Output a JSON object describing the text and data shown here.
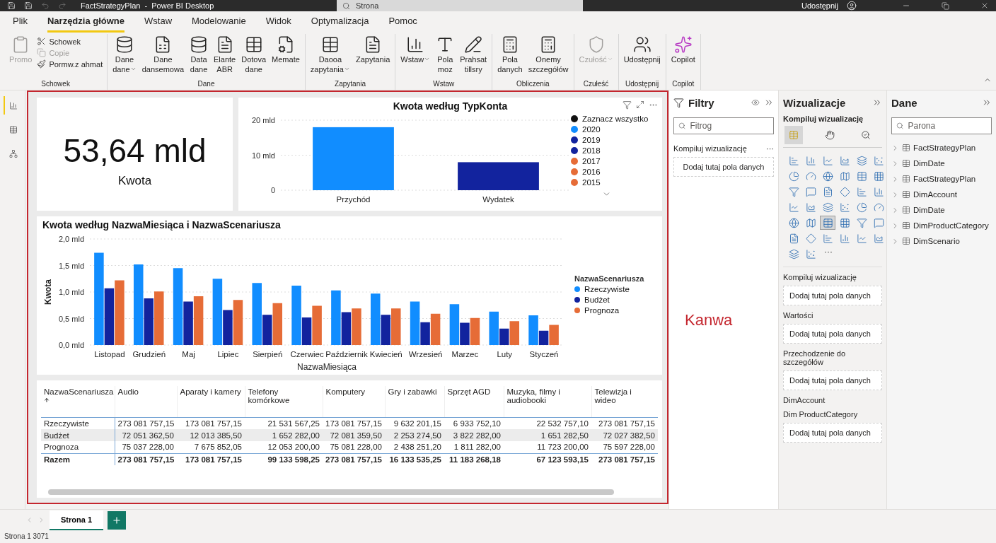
{
  "title_bar": {
    "title": "FactStrategyPlan  -  Power BI Desktop",
    "search": {
      "placeholder": "Strona"
    },
    "share": "Udostępnij"
  },
  "ribbon_tabs": [
    {
      "label": "Plik",
      "selected": false
    },
    {
      "label": "Narzędzia główne",
      "selected": true
    },
    {
      "label": "Wstaw",
      "selected": false
    },
    {
      "label": "Modelowanie",
      "selected": false
    },
    {
      "label": "Widok",
      "selected": false
    },
    {
      "label": "Optymalizacja",
      "selected": false
    },
    {
      "label": "Pomoc",
      "selected": false
    }
  ],
  "ribbon_groups": [
    {
      "label": "Schowek",
      "buttons": [
        {
          "kind": "large",
          "label": "Promo",
          "disabled": true,
          "dropdown": false
        },
        {
          "kind": "small",
          "label": "Schowek",
          "disabled": false,
          "dropdown": false
        },
        {
          "kind": "small",
          "label": "Copie",
          "disabled": true,
          "dropdown": false
        },
        {
          "kind": "small",
          "label": "Pormw.z ahmat",
          "disabled": false,
          "dropdown": false
        }
      ]
    },
    {
      "label": "Dane",
      "buttons": [
        {
          "kind": "large",
          "label": "Dane\ndane",
          "disabled": false,
          "dropdown": true
        },
        {
          "kind": "large",
          "label": "Dane\ndansemowa",
          "disabled": false,
          "dropdown": false
        },
        {
          "kind": "large",
          "label": "Data\ndane",
          "disabled": false,
          "dropdown": false
        },
        {
          "kind": "large",
          "label": "Elante\nABR",
          "disabled": false,
          "dropdown": false
        },
        {
          "kind": "large",
          "label": "Dotova\ndane",
          "disabled": false,
          "dropdown": false
        },
        {
          "kind": "large",
          "label": "Memate",
          "disabled": false,
          "dropdown": false
        }
      ]
    },
    {
      "label": "Zapytania",
      "buttons": [
        {
          "kind": "large",
          "label": "Daooa\nzapytania",
          "disabled": false,
          "dropdown": true
        },
        {
          "kind": "large",
          "label": "Zapytania",
          "disabled": false,
          "dropdown": false
        }
      ]
    },
    {
      "label": "Wstaw",
      "buttons": [
        {
          "kind": "large",
          "label": "Wstaw",
          "disabled": false,
          "dropdown": true
        },
        {
          "kind": "large",
          "label": "Pola\nmoz",
          "disabled": false,
          "dropdown": false
        },
        {
          "kind": "large",
          "label": "Prahsat\ntillsry",
          "disabled": false,
          "dropdown": false
        }
      ]
    },
    {
      "label": "Obliczenia",
      "buttons": [
        {
          "kind": "large",
          "label": "Pola\ndanych",
          "disabled": false,
          "dropdown": false
        },
        {
          "kind": "large",
          "label": "Onemy\nszczegółów",
          "disabled": false,
          "dropdown": false
        }
      ]
    },
    {
      "label": "Czułeść",
      "buttons": [
        {
          "kind": "large",
          "label": "Czułość",
          "disabled": true,
          "dropdown": true
        }
      ]
    },
    {
      "label": "Udostępnij",
      "buttons": [
        {
          "kind": "large",
          "label": "Udostępnij",
          "disabled": false,
          "dropdown": false
        }
      ]
    },
    {
      "label": "Copilot",
      "buttons": [
        {
          "kind": "large",
          "label": "Copilot",
          "disabled": false,
          "dropdown": false
        }
      ]
    }
  ],
  "views": [
    {
      "selected": true
    },
    {
      "selected": false
    },
    {
      "selected": false
    }
  ],
  "card": {
    "value": "53,64 mld",
    "label": "Kwota"
  },
  "chart_top": {
    "legend": [
      {
        "label": "Zaznacz wszystko",
        "color": "#111111"
      },
      {
        "label": "2020",
        "color": "#118dff"
      },
      {
        "label": "2019",
        "color": "#12239e"
      },
      {
        "label": "2018",
        "color": "#12239e"
      },
      {
        "label": "2017",
        "color": "#e66c37"
      },
      {
        "label": "2016",
        "color": "#e66c37"
      },
      {
        "label": "2015",
        "color": "#e66c37"
      }
    ],
    "chart_data": {
      "type": "bar",
      "title": "Kwota według TypKonta",
      "categories": [
        "Przychód",
        "Wydatek"
      ],
      "stacked": true,
      "ylim": [
        0,
        20
      ],
      "yticks": [
        {
          "value": 0,
          "label": "0"
        },
        {
          "value": 10,
          "label": "10 mld"
        },
        {
          "value": 20,
          "label": "20 mld"
        }
      ],
      "grid": true,
      "series": [
        {
          "color": "#118dff",
          "values": [
            18,
            null
          ]
        },
        {
          "color": "#12239e",
          "values": [
            null,
            8
          ]
        }
      ]
    }
  },
  "chart_months": {
    "legend_title": "NazwaScenariusza",
    "chart_data": {
      "type": "bar",
      "title": "Kwota według NazwaMiesiąca i NazwaScenariusza",
      "xlabel": "NazwaMiesiąca",
      "ylabel": "Kwota",
      "stacked": false,
      "grid": true,
      "categories": [
        "Listopad",
        "Grudzień",
        "Maj",
        "Lipiec",
        "Sierpień",
        "Czerwiec",
        "Październik",
        "Kwiecień",
        "Wrzesień",
        "Marzec",
        "Luty",
        "Styczeń"
      ],
      "ylim": [
        0,
        2
      ],
      "yticks": [
        {
          "value": 0,
          "label": "0,0 mld"
        },
        {
          "value": 0.5,
          "label": "0,5 mld"
        },
        {
          "value": 1,
          "label": "1,0 mld"
        },
        {
          "value": 1.5,
          "label": "1,5 mld"
        },
        {
          "value": 2,
          "label": "2,0 mld"
        }
      ],
      "series": [
        {
          "name": "Rzeczywiste",
          "color": "#118dff",
          "values": [
            1.74,
            1.52,
            1.45,
            1.25,
            1.17,
            1.12,
            1.03,
            0.97,
            0.82,
            0.77,
            0.63,
            0.56
          ]
        },
        {
          "name": "Budżet",
          "color": "#12239e",
          "values": [
            1.07,
            0.88,
            0.82,
            0.66,
            0.57,
            0.52,
            0.62,
            0.57,
            0.43,
            0.42,
            0.31,
            0.27
          ]
        },
        {
          "name": "Prognoza",
          "color": "#e66c37",
          "values": [
            1.22,
            1.01,
            0.92,
            0.85,
            0.79,
            0.74,
            0.69,
            0.69,
            0.59,
            0.51,
            0.45,
            0.38
          ]
        }
      ]
    }
  },
  "table": {
    "columns": [
      {
        "label": "NazwaScenariusza",
        "sorted": true
      },
      {
        "label": "Audio",
        "sorted": false
      },
      {
        "label": "Aparaty i kamery",
        "sorted": false
      },
      {
        "label": "Telefony komórkowe",
        "sorted": false
      },
      {
        "label": "Komputery",
        "sorted": false
      },
      {
        "label": "Gry i zabawki",
        "sorted": false
      },
      {
        "label": "Sprzęt AGD",
        "sorted": false
      },
      {
        "label": "Muzyka, filmy i audiobooki",
        "sorted": false
      },
      {
        "label": "Telewizja i wideo",
        "sorted": false
      }
    ],
    "rows": [
      {
        "kind": "data",
        "cells": [
          "Rzeczywiste",
          "273 081 757,15",
          "173 081 757,15",
          "21 531 567,25",
          "173 081 757,15",
          "9 632 201,15",
          "6 933 752,10",
          "22 532 757,10",
          "273 081 757,15"
        ]
      },
      {
        "kind": "data",
        "cells": [
          "Budżet",
          "72 051 362,50",
          "12 013 385,50",
          "1 652 282,00",
          "72 081 359,50",
          "2 253 274,50",
          "3 822 282,00",
          "1 651 282,50",
          "72 027 382,50"
        ]
      },
      {
        "kind": "data",
        "cells": [
          "Prognoza",
          "75 037 228,00",
          "7 675 852,05",
          "12 053 200,00",
          "75 081 228,00",
          "2 438 251,20",
          "1 811 282,00",
          "11 723 200,00",
          "75 597 228,00"
        ]
      },
      {
        "kind": "total",
        "cells": [
          "Razem",
          "273 081 757,15",
          "173 081 757,15",
          "99 133 598,25",
          "273 081 757,15",
          "16 133 535,25",
          "11 183 268,18",
          "67 123 593,15",
          "273 081 757,15"
        ]
      }
    ]
  },
  "annotation": {
    "label": "Kanwa"
  },
  "filters": {
    "title": "Filtry",
    "search": {
      "placeholder": "Fitrog"
    },
    "section": "Kompiluj wizualizację",
    "more": "···",
    "drop_text": "Dodaj tutaj pola danych"
  },
  "visualizations": {
    "title": "Wizualizacje",
    "subtitle": "Kompiluj wizualizację",
    "pane_tabs": [
      {
        "selected": true
      },
      {
        "selected": false
      },
      {
        "selected": false
      }
    ],
    "visual_types": [
      {
        "selected": false
      },
      {
        "selected": false
      },
      {
        "selected": false
      },
      {
        "selected": false
      },
      {
        "selected": false
      },
      {
        "selected": false
      },
      {
        "selected": false
      },
      {
        "selected": false
      },
      {
        "selected": false
      },
      {
        "selected": false
      },
      {
        "selected": false
      },
      {
        "selected": false
      },
      {
        "selected": false
      },
      {
        "selected": false
      },
      {
        "selected": false
      },
      {
        "selected": false
      },
      {
        "selected": false
      },
      {
        "selected": false
      },
      {
        "selected": false
      },
      {
        "selected": false
      },
      {
        "selected": false
      },
      {
        "selected": false
      },
      {
        "selected": false
      },
      {
        "selected": false
      },
      {
        "selected": false
      },
      {
        "selected": false
      },
      {
        "selected": true
      },
      {
        "selected": false
      },
      {
        "selected": false
      },
      {
        "selected": false
      },
      {
        "selected": false
      },
      {
        "selected": false
      },
      {
        "selected": false
      },
      {
        "selected": false
      },
      {
        "selected": false
      },
      {
        "selected": false
      },
      {
        "selected": false
      },
      {
        "selected": false
      }
    ],
    "more": "···",
    "wells": [
      {
        "label": "Kompiluj wizualizację",
        "drop_text": "Dodaj tutaj pola danych"
      },
      {
        "label": "Wartości",
        "drop_text": "Dodaj tutaj pola danych"
      },
      {
        "label": "Przechodzenie do szczegółów",
        "drop_text": "Dodaj tutaj pola danych"
      },
      {
        "label": "DimAccount"
      },
      {
        "label": "Dim ProductCategory",
        "drop_text": "Dodaj tutaj pola danych"
      }
    ]
  },
  "data_pane": {
    "title": "Dane",
    "search": {
      "placeholder": "Parona"
    },
    "tables": [
      {
        "label": "FactStrategyPlan",
        "expanded": false
      },
      {
        "label": "DimDate",
        "expanded": false
      },
      {
        "label": "FactStrategyPlan",
        "expanded": false
      },
      {
        "label": "DimAccount",
        "expanded": false
      },
      {
        "label": "DimDate",
        "expanded": false
      },
      {
        "label": "DimProductCategory",
        "expanded": false
      },
      {
        "label": "DimScenario",
        "expanded": false
      }
    ]
  },
  "pages": [
    {
      "label": "Strona 1",
      "selected": true
    }
  ],
  "status_bar": "Strona 1 3071"
}
